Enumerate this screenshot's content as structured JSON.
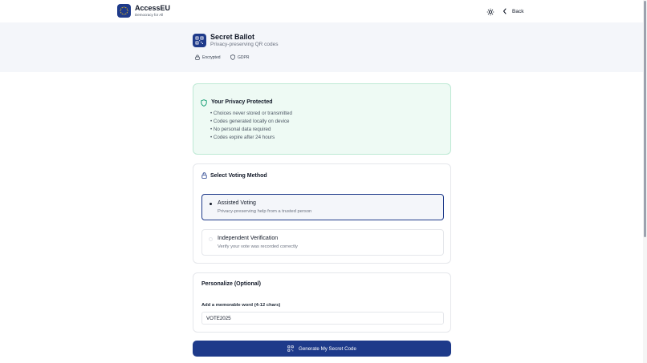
{
  "header": {
    "brand_name": "AccessEU",
    "brand_tagline": "Democracy for All",
    "back_label": "Back",
    "icons": {
      "logo": "eu-stars-icon",
      "theme": "sun-icon",
      "back": "chevron-left-icon"
    }
  },
  "hero": {
    "title": "Secret Ballot",
    "subtitle": "Privacy-preserving QR codes",
    "badges": [
      {
        "label": "Encrypted",
        "icon": "lock-icon"
      },
      {
        "label": "GDPR",
        "icon": "shield-icon"
      }
    ]
  },
  "privacy": {
    "title": "Your Privacy Protected",
    "items": [
      "• Choices never stored or transmitted",
      "• Codes generated locally on device",
      "• No personal data required",
      "• Codes expire after 24 hours"
    ]
  },
  "voting_method": {
    "title": "Select Voting Method",
    "options": [
      {
        "title": "Assisted Voting",
        "description": "Privacy-preserving help from a trusted person",
        "selected": true
      },
      {
        "title": "Independent Verification",
        "description": "Verify your vote was recorded correctly",
        "selected": false
      }
    ]
  },
  "personalize": {
    "title": "Personalize (Optional)",
    "field_label": "Add a memorable word (4-12 chars)",
    "field_value": "VOTE2025"
  },
  "generate_button": {
    "label": "Generate My Secret Code",
    "icon": "qr-code-icon"
  },
  "colors": {
    "primary": "#1e3a8a",
    "privacy_bg": "#eefaf4",
    "privacy_border": "#bde9d4",
    "hero_bg": "#f4f6fa",
    "shield_green": "#059669"
  }
}
